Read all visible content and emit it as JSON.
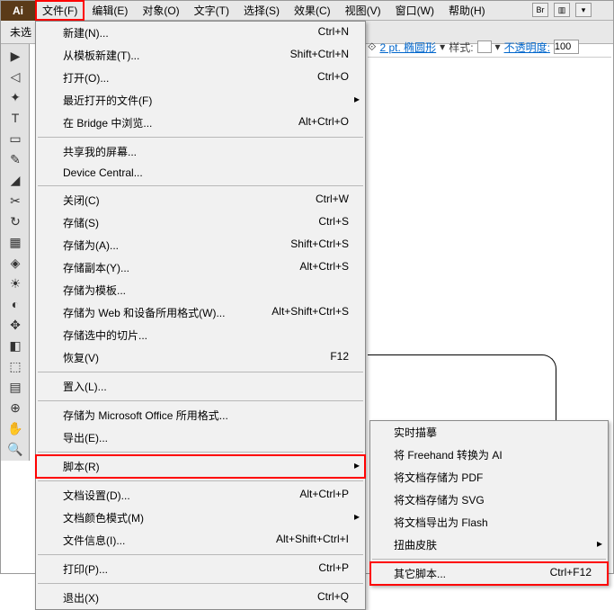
{
  "menubar": {
    "items": [
      "文件(F)",
      "编辑(E)",
      "对象(O)",
      "文字(T)",
      "选择(S)",
      "效果(C)",
      "视图(V)",
      "窗口(W)",
      "帮助(H)"
    ]
  },
  "appicon": "Ai",
  "brbtn": "Br",
  "toolbar": {
    "unsel": "未选"
  },
  "opts": {
    "stroke": "2 pt. 椭圆形",
    "style": "样式:",
    "opacity": "不透明度:",
    "opval": "100",
    "dd": "▾"
  },
  "fileMenu": [
    {
      "t": "item",
      "l": "新建(N)...",
      "s": "Ctrl+N"
    },
    {
      "t": "item",
      "l": "从模板新建(T)...",
      "s": "Shift+Ctrl+N"
    },
    {
      "t": "item",
      "l": "打开(O)...",
      "s": "Ctrl+O"
    },
    {
      "t": "item",
      "l": "最近打开的文件(F)",
      "arrow": true
    },
    {
      "t": "item",
      "l": "在 Bridge 中浏览...",
      "s": "Alt+Ctrl+O"
    },
    {
      "t": "sep"
    },
    {
      "t": "item",
      "l": "共享我的屏幕..."
    },
    {
      "t": "item",
      "l": "Device Central..."
    },
    {
      "t": "sep"
    },
    {
      "t": "item",
      "l": "关闭(C)",
      "s": "Ctrl+W"
    },
    {
      "t": "item",
      "l": "存储(S)",
      "s": "Ctrl+S"
    },
    {
      "t": "item",
      "l": "存储为(A)...",
      "s": "Shift+Ctrl+S"
    },
    {
      "t": "item",
      "l": "存储副本(Y)...",
      "s": "Alt+Ctrl+S"
    },
    {
      "t": "item",
      "l": "存储为模板..."
    },
    {
      "t": "item",
      "l": "存储为 Web 和设备所用格式(W)...",
      "s": "Alt+Shift+Ctrl+S"
    },
    {
      "t": "item",
      "l": "存储选中的切片..."
    },
    {
      "t": "item",
      "l": "恢复(V)",
      "s": "F12"
    },
    {
      "t": "sep"
    },
    {
      "t": "item",
      "l": "置入(L)..."
    },
    {
      "t": "sep"
    },
    {
      "t": "item",
      "l": "存储为 Microsoft Office 所用格式..."
    },
    {
      "t": "item",
      "l": "导出(E)..."
    },
    {
      "t": "sep"
    },
    {
      "t": "item",
      "l": "脚本(R)",
      "arrow": true,
      "hl": true
    },
    {
      "t": "sep"
    },
    {
      "t": "item",
      "l": "文档设置(D)...",
      "s": "Alt+Ctrl+P"
    },
    {
      "t": "item",
      "l": "文档颜色模式(M)",
      "arrow": true
    },
    {
      "t": "item",
      "l": "文件信息(I)...",
      "s": "Alt+Shift+Ctrl+I"
    },
    {
      "t": "sep"
    },
    {
      "t": "item",
      "l": "打印(P)...",
      "s": "Ctrl+P"
    },
    {
      "t": "sep"
    },
    {
      "t": "item",
      "l": "退出(X)",
      "s": "Ctrl+Q"
    }
  ],
  "scriptMenu": [
    {
      "t": "item",
      "l": "实时描摹"
    },
    {
      "t": "item",
      "l": "将 Freehand 转换为 AI"
    },
    {
      "t": "item",
      "l": "将文档存储为 PDF"
    },
    {
      "t": "item",
      "l": "将文档存储为 SVG"
    },
    {
      "t": "item",
      "l": "将文档导出为 Flash"
    },
    {
      "t": "item",
      "l": "扭曲皮肤",
      "arrow": true
    },
    {
      "t": "sep"
    },
    {
      "t": "item",
      "l": "其它脚本...",
      "s": "Ctrl+F12",
      "hl": true
    }
  ],
  "tools": [
    "▶",
    "◁",
    "✦",
    "T",
    "▭",
    "✎",
    "◢",
    "✂",
    "↻",
    "▦",
    "◈",
    "☀",
    "◐",
    "✥",
    "◧",
    "⬚",
    "▤",
    "⊕",
    "✋",
    "🔍"
  ]
}
